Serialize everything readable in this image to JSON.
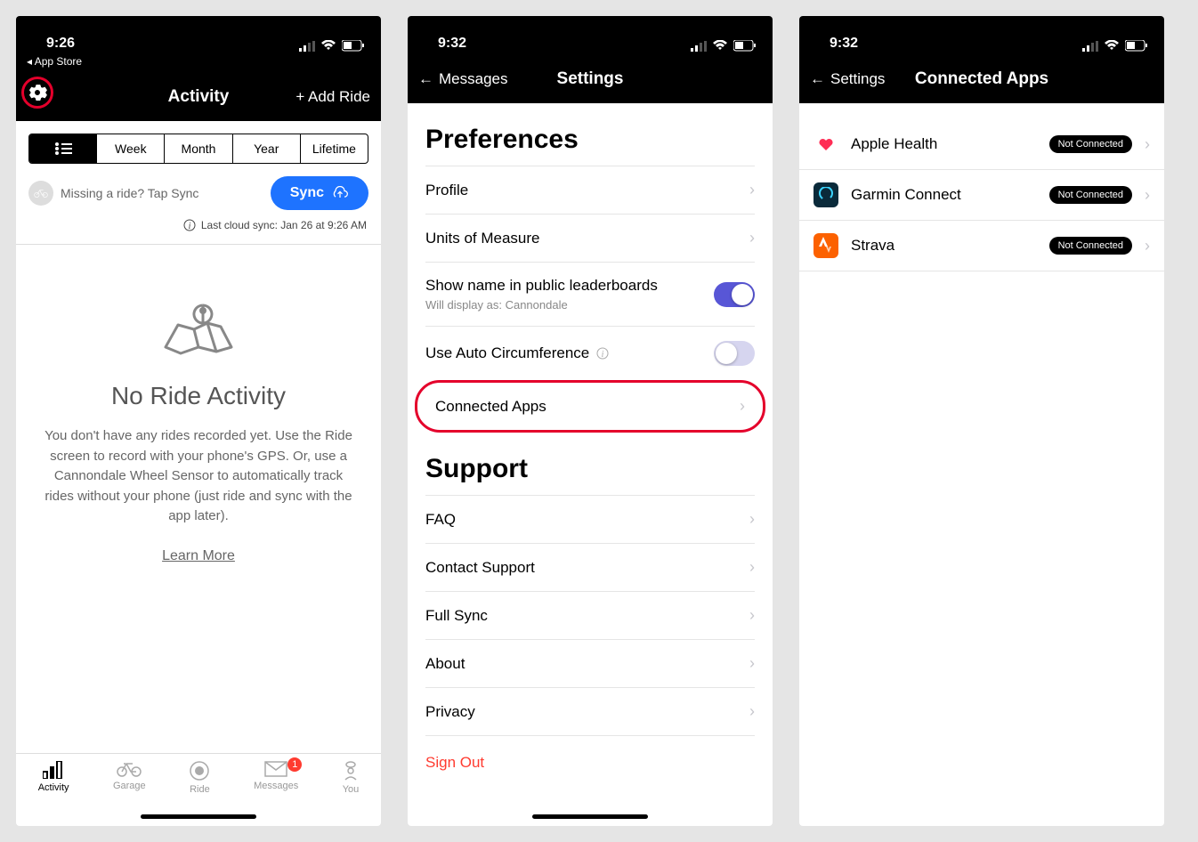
{
  "screen1": {
    "status_time": "9:26",
    "back_app": "◂ App Store",
    "nav_title": "Activity",
    "nav_add": "+ Add Ride",
    "tabs": [
      "Week",
      "Month",
      "Year",
      "Lifetime"
    ],
    "sync_hint": "Missing a ride? Tap Sync",
    "sync_btn": "Sync",
    "last_sync": "Last cloud sync: Jan 26 at 9:26 AM",
    "empty_title": "No Ride Activity",
    "empty_desc": "You don't have any rides recorded yet. Use the Ride screen to record with your phone's GPS. Or, use a Cannondale Wheel Sensor to automatically track rides without your phone (just ride and sync with the app later).",
    "learn_more": "Learn More",
    "tabbar": {
      "activity": "Activity",
      "garage": "Garage",
      "ride": "Ride",
      "messages": "Messages",
      "you": "You",
      "badge": "1"
    }
  },
  "screen2": {
    "status_time": "9:32",
    "nav_back": "Messages",
    "nav_title": "Settings",
    "section_pref": "Preferences",
    "rows": {
      "profile": "Profile",
      "units": "Units of Measure",
      "show_name": "Show name in public leaderboards",
      "show_name_sub": "Will display as: Cannondale",
      "auto_circ": "Use Auto Circumference",
      "connected": "Connected Apps"
    },
    "section_support": "Support",
    "support_rows": {
      "faq": "FAQ",
      "contact": "Contact Support",
      "fullsync": "Full Sync",
      "about": "About",
      "privacy": "Privacy"
    },
    "signout": "Sign Out"
  },
  "screen3": {
    "status_time": "9:32",
    "nav_back": "Settings",
    "nav_title": "Connected Apps",
    "apps": {
      "health": {
        "label": "Apple Health",
        "status": "Not Connected"
      },
      "garmin": {
        "label": "Garmin Connect",
        "status": "Not Connected"
      },
      "strava": {
        "label": "Strava",
        "status": "Not Connected"
      }
    }
  }
}
